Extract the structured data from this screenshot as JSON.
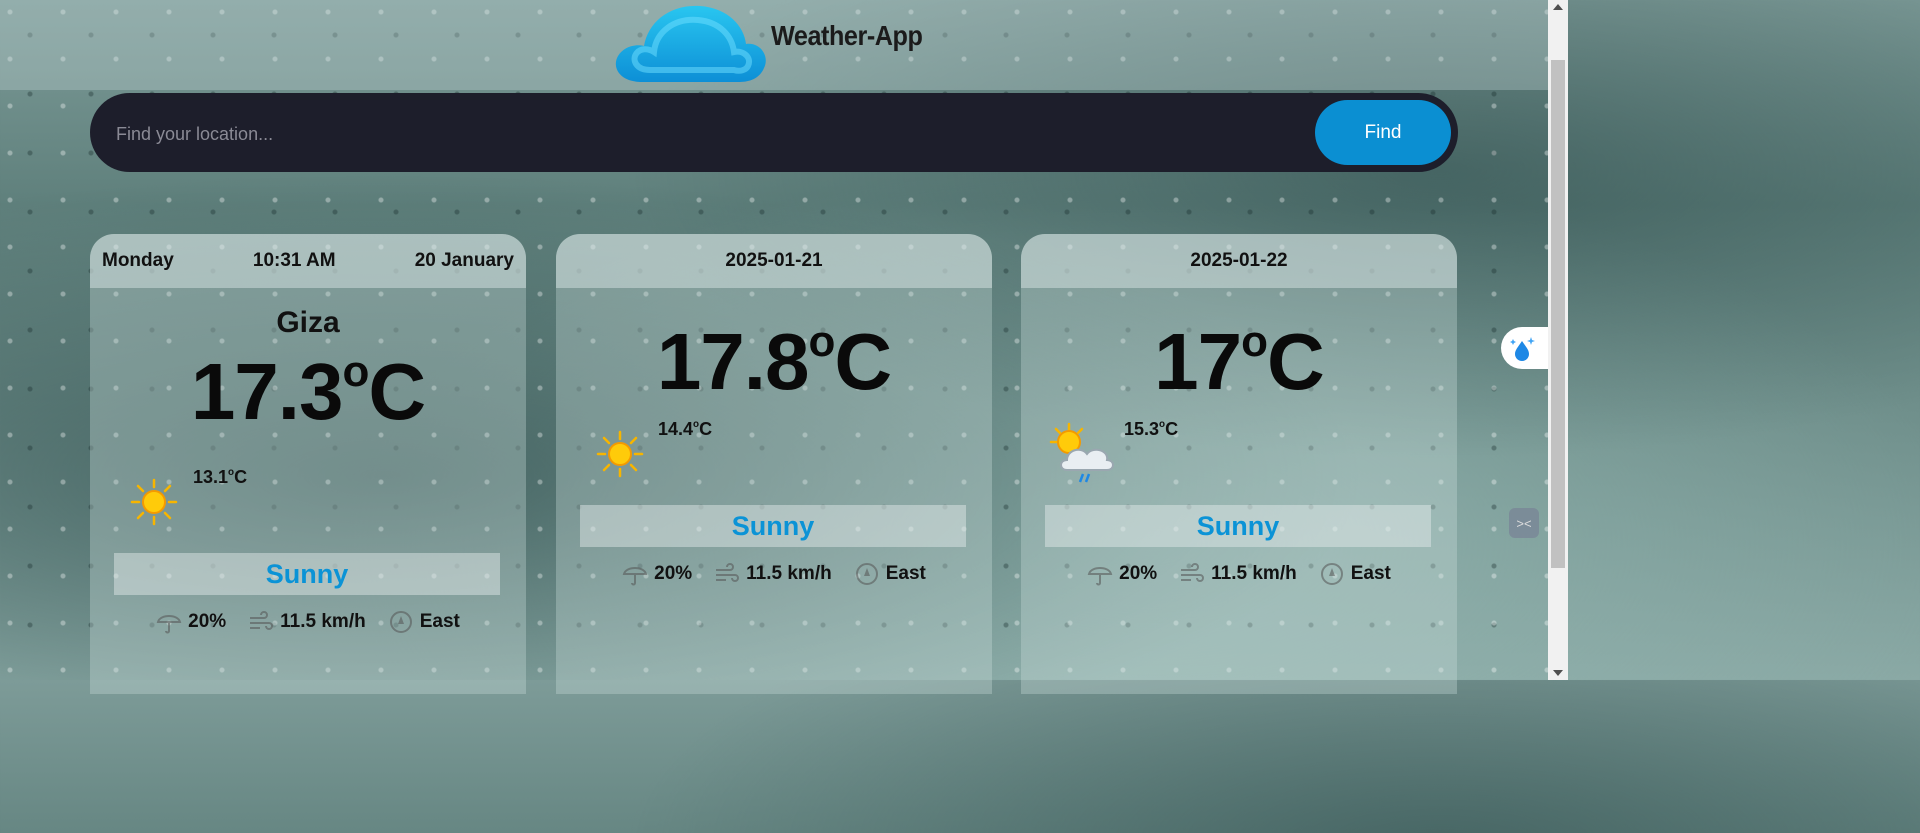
{
  "app": {
    "title": "Weather-App"
  },
  "search": {
    "placeholder": "Find your location...",
    "button_label": "Find"
  },
  "cards": [
    {
      "day": "Monday",
      "time": "10:31 AM",
      "date": "20 January",
      "city": "Giza",
      "temp_value": "17.3",
      "temp_unit": "C",
      "min_value": "13.1",
      "min_unit": "C",
      "icon": "sun-icon",
      "condition": "Sunny",
      "humidity": "20%",
      "wind": "11.5 km/h",
      "direction": "East"
    },
    {
      "date": "2025-01-21",
      "temp_value": "17.8",
      "temp_unit": "C",
      "min_value": "14.4",
      "min_unit": "C",
      "icon": "sun-icon",
      "condition": "Sunny",
      "humidity": "20%",
      "wind": "11.5 km/h",
      "direction": "East"
    },
    {
      "date": "2025-01-22",
      "temp_value": "17",
      "temp_unit": "C",
      "min_value": "15.3",
      "min_unit": "C",
      "icon": "sun-cloud-rain-icon",
      "condition": "Sunny",
      "humidity": "20%",
      "wind": "11.5 km/h",
      "direction": "East"
    }
  ],
  "colors": {
    "accent": "#0b8fd2",
    "search_bg": "#1d1e2b",
    "condition": "#0b93d6"
  },
  "degree_symbol": "o"
}
